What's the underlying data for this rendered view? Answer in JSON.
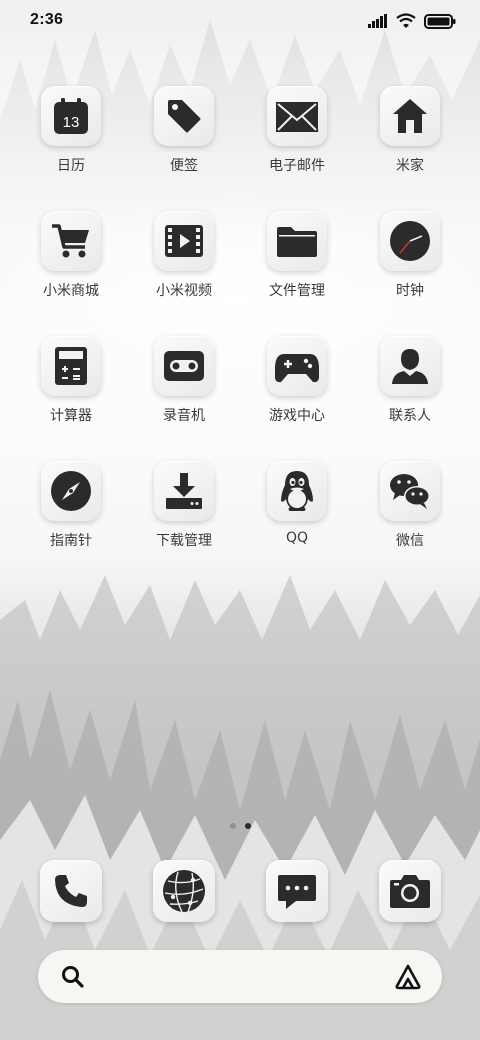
{
  "status_bar": {
    "time": "2:36"
  },
  "apps": [
    {
      "label": "日历",
      "icon": "calendar-icon",
      "calendar_day": "13"
    },
    {
      "label": "便签",
      "icon": "tag-icon"
    },
    {
      "label": "电子邮件",
      "icon": "mail-icon"
    },
    {
      "label": "米家",
      "icon": "home-icon"
    },
    {
      "label": "小米商城",
      "icon": "cart-icon"
    },
    {
      "label": "小米视频",
      "icon": "video-icon"
    },
    {
      "label": "文件管理",
      "icon": "folder-icon"
    },
    {
      "label": "时钟",
      "icon": "clock-icon"
    },
    {
      "label": "计算器",
      "icon": "calculator-icon"
    },
    {
      "label": "录音机",
      "icon": "recorder-icon"
    },
    {
      "label": "游戏中心",
      "icon": "gamepad-icon"
    },
    {
      "label": "联系人",
      "icon": "contact-icon"
    },
    {
      "label": "指南针",
      "icon": "compass-icon"
    },
    {
      "label": "下载管理",
      "icon": "download-icon"
    },
    {
      "label": "QQ",
      "icon": "qq-icon"
    },
    {
      "label": "微信",
      "icon": "wechat-icon"
    }
  ],
  "page_indicator": {
    "pages": 2,
    "current": 2
  },
  "dock": [
    {
      "icon": "phone-icon"
    },
    {
      "icon": "browser-icon"
    },
    {
      "icon": "messages-icon"
    },
    {
      "icon": "camera-icon"
    }
  ],
  "search_bar": {
    "left_icon": "search-icon",
    "right_icon": "assistant-icon"
  },
  "colors": {
    "icon_glyph": "#2b2b2b",
    "tile_bg": "#f2f2f2",
    "label": "#3a3a3a",
    "clock_hand": "#c0392b"
  }
}
